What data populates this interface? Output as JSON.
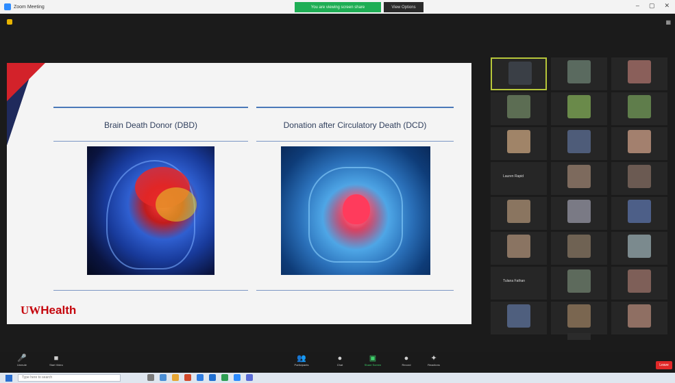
{
  "window": {
    "title": "Zoom Meeting"
  },
  "share_bar": {
    "label": "You are viewing screen share",
    "view_options": "View Options"
  },
  "slide": {
    "left_header": "Brain Death Donor (DBD)",
    "right_header": "Donation after Circulatory Death (DCD)",
    "logo_uw": "UW",
    "logo_health": "Health"
  },
  "gallery": {
    "tiles": [
      {
        "name": "",
        "color": "#3a3f46"
      },
      {
        "name": "",
        "color": "#5a6a5f"
      },
      {
        "name": "",
        "color": "#8a5f5a"
      },
      {
        "name": "",
        "color": "#5c6d53"
      },
      {
        "name": "",
        "color": "#6a8a4a"
      },
      {
        "name": "",
        "color": "#5f7d4b"
      },
      {
        "name": "",
        "color": "#a08468"
      },
      {
        "name": "",
        "color": "#4e5c79"
      },
      {
        "name": "",
        "color": "#a3806e"
      },
      {
        "name": "Lauren Rapid",
        "color": ""
      },
      {
        "name": "",
        "color": "#7d6a5d"
      },
      {
        "name": "",
        "color": "#6b5a52"
      },
      {
        "name": "",
        "color": "#8a7560"
      },
      {
        "name": "",
        "color": "#7a7a85"
      },
      {
        "name": "",
        "color": "#4d5f88"
      },
      {
        "name": "",
        "color": "#8a7462"
      },
      {
        "name": "",
        "color": "#6f6253"
      },
      {
        "name": "",
        "color": "#7b8a8e"
      },
      {
        "name": "Tulana Fathan",
        "color": ""
      },
      {
        "name": "",
        "color": "#5d6a5c"
      },
      {
        "name": "",
        "color": "#7e5f58"
      },
      {
        "name": "",
        "color": "#4f5f7e"
      },
      {
        "name": "",
        "color": "#7a6650"
      },
      {
        "name": "",
        "color": "#8f6f63"
      }
    ],
    "page_button": ""
  },
  "toolbar": {
    "mute": "Unmute",
    "video": "Start Video",
    "participants": "Participants",
    "chat": "Chat",
    "share": "Share Screen",
    "record": "Record",
    "reactions": "Reactions",
    "leave": "Leave"
  },
  "taskbar": {
    "search_placeholder": "Type here to search",
    "time": "",
    "date": ""
  }
}
